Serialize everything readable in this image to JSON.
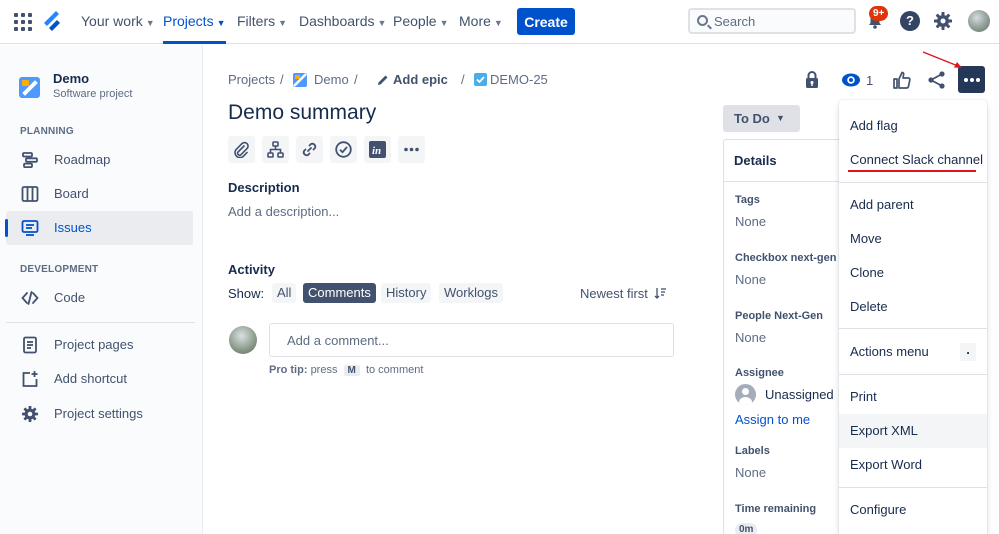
{
  "topnav": {
    "items": [
      {
        "label": "Your work"
      },
      {
        "label": "Projects"
      },
      {
        "label": "Filters"
      },
      {
        "label": "Dashboards"
      },
      {
        "label": "People"
      },
      {
        "label": "More"
      }
    ],
    "create_label": "Create",
    "search_placeholder": "Search",
    "notification_count": "9+",
    "help_glyph": "?"
  },
  "sidebar": {
    "project_name": "Demo",
    "project_type": "Software project",
    "sections": [
      {
        "heading": "PLANNING",
        "items": [
          {
            "label": "Roadmap",
            "icon": "roadmap-icon"
          },
          {
            "label": "Board",
            "icon": "board-icon"
          },
          {
            "label": "Issues",
            "icon": "issues-icon"
          }
        ]
      },
      {
        "heading": "DEVELOPMENT",
        "items": [
          {
            "label": "Code",
            "icon": "code-icon"
          }
        ]
      }
    ],
    "footer_items": [
      {
        "label": "Project pages",
        "icon": "pages-icon"
      },
      {
        "label": "Add shortcut",
        "icon": "add-shortcut-icon"
      },
      {
        "label": "Project settings",
        "icon": "gear-icon"
      }
    ],
    "active_item": "Issues"
  },
  "breadcrumb": {
    "projects": "Projects",
    "project": "Demo",
    "epic": "Add epic",
    "issue_key": "DEMO-25",
    "separator": "/"
  },
  "issue": {
    "title": "Demo summary",
    "description_heading": "Description",
    "description_placeholder": "Add a description...",
    "watch_count": "1"
  },
  "activity": {
    "heading": "Activity",
    "show_label": "Show:",
    "filters": [
      "All",
      "Comments",
      "History",
      "Worklogs"
    ],
    "selected_filter": "Comments",
    "sort_label": "Newest first",
    "comment_placeholder": "Add a comment...",
    "tip_prefix": "Pro tip:",
    "tip_press": "press",
    "tip_key": "M",
    "tip_suffix": "to comment"
  },
  "status": {
    "label": "To Do"
  },
  "details": {
    "heading": "Details",
    "fields": [
      {
        "label": "Tags",
        "value": "None"
      },
      {
        "label": "Checkbox next-gen",
        "value": "None"
      },
      {
        "label": "People Next-Gen",
        "value": "None"
      },
      {
        "label": "Assignee",
        "value": "Unassigned",
        "action": "Assign to me"
      },
      {
        "label": "Labels",
        "value": "None"
      },
      {
        "label": "Time remaining",
        "value": "0m"
      }
    ]
  },
  "more_menu": {
    "items": [
      {
        "label": "Add flag"
      },
      {
        "label": "Connect Slack channel"
      },
      {
        "label": "Add parent"
      },
      {
        "label": "Move"
      },
      {
        "label": "Clone"
      },
      {
        "label": "Delete"
      },
      {
        "label": "Actions menu",
        "shortcut": "."
      },
      {
        "label": "Print"
      },
      {
        "label": "Export XML"
      },
      {
        "label": "Export Word"
      },
      {
        "label": "Configure"
      }
    ],
    "hovered": "Export XML"
  },
  "colors": {
    "brand_blue": "#0052cc",
    "annotation_red": "#e0131c",
    "text_primary": "#172b4d",
    "text_subtle": "#5e6c84"
  }
}
